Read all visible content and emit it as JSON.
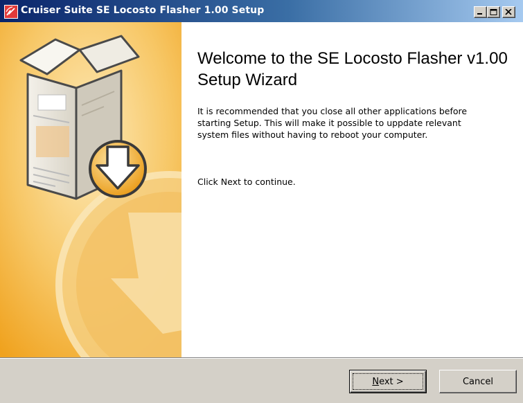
{
  "window": {
    "title": "Cruiser Suite SE Locosto Flasher 1.00 Setup",
    "controls": [
      "minimize-icon",
      "maximize-icon",
      "close-icon"
    ]
  },
  "wizard": {
    "heading": "Welcome to the SE Locosto Flasher v1.00 Setup Wizard",
    "paragraph1": "It is recommended that you close all other applications before starting Setup. This will make it possible to uppdate relevant system files without having to reboot your computer.",
    "paragraph2": "Click Next to continue.",
    "banner_icon": "installer-box-download-icon"
  },
  "buttons": {
    "next_mnemonic": "N",
    "next_rest": "ext >",
    "cancel": "Cancel"
  },
  "colors": {
    "titlebar_start": "#0a246a",
    "titlebar_end": "#a6caf0",
    "banner_orange": "#f3a21c",
    "banner_light": "#fcebc3",
    "dialog_face": "#d4d0c8"
  }
}
